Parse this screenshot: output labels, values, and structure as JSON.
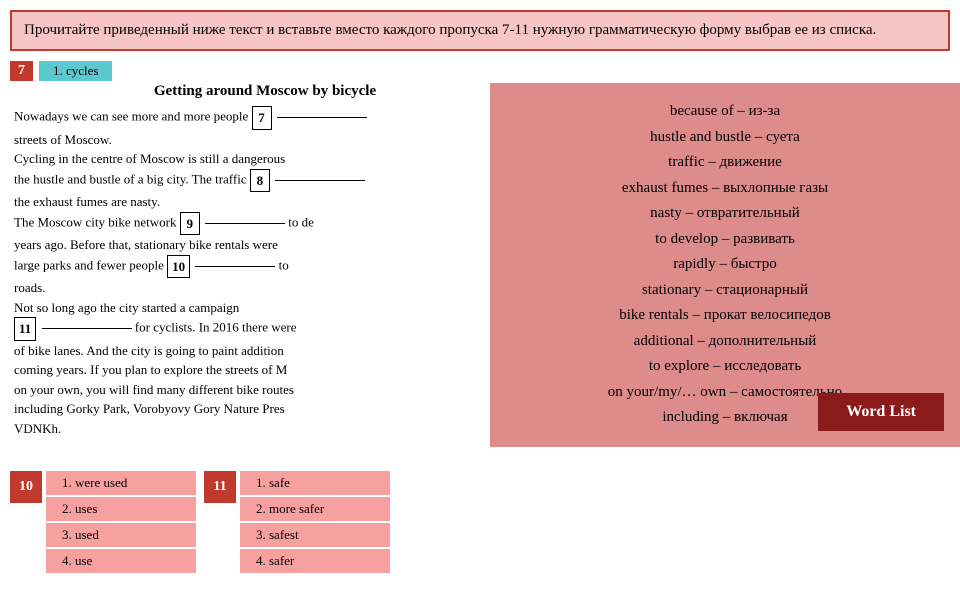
{
  "instruction": {
    "text": "Прочитайте приведенный ниже текст и вставьте вместо каждого пропуска 7-11 нужную грамматическую форму выбрав ее из списка."
  },
  "article": {
    "title": "Getting around Moscow by bicycle",
    "paragraphs": [
      "Nowadays we can see more and more people [7] ___ streets of Moscow.",
      "Cycling in the centre of Moscow is still a dangerous the hustle and bustle of a big city. The traffic [8] ___ the exhaust fumes are nasty.",
      "The Moscow city bike network [9] __________ to de years ago. Before that, stationary bike rentals were large parks and fewer people [10] __________ to roads.",
      "Not so long ago the city started a campaign [11] __________ for cyclists. In 2016 there were of bike lanes. And the city is going to paint addition coming years. If you plan to explore the streets of M on your own, you will find many different bike routes including Gorky Park, Vorobyovy Gory Nature Pres VDNKh."
    ]
  },
  "word_list": {
    "title": "Word List",
    "items": [
      "because of – из-за",
      "hustle and bustle – суета",
      "traffic – движение",
      "exhaust fumes – выхлопные газы",
      "nasty – отвратительный",
      "to develop – развивать",
      "rapidly – быстро",
      "stationary – стационарный",
      "bike rentals – прокат велосипедов",
      "additional – дополнительный",
      "to explore – исследовать",
      "on your/my/… own – самостоятельно",
      "including – включая"
    ],
    "button_label": "Word List"
  },
  "question_10": {
    "number": "10",
    "choices": [
      "1. were used",
      "2. uses",
      "3. used",
      "4. use"
    ]
  },
  "question_11": {
    "number": "11",
    "choices": [
      "1. safe",
      "2. more safer",
      "3. safest",
      "4. safer"
    ]
  },
  "header_tab": {
    "number": "7",
    "label": "1. cycles"
  }
}
